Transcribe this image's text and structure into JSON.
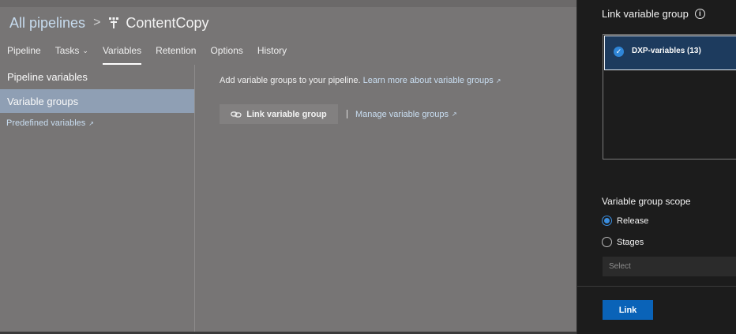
{
  "header": {
    "breadcrumb_root": "All pipelines",
    "separator": ">",
    "pipeline_name": "ContentCopy"
  },
  "tabs": [
    {
      "label": "Pipeline"
    },
    {
      "label": "Tasks"
    },
    {
      "label": "Variables",
      "active": true
    },
    {
      "label": "Retention"
    },
    {
      "label": "Options"
    },
    {
      "label": "History"
    }
  ],
  "sidebar": {
    "pipeline_variables": "Pipeline variables",
    "variable_groups": "Variable groups",
    "predefined_variables": "Predefined variables"
  },
  "content": {
    "intro_text": "Add variable groups to your pipeline.",
    "learn_more": "Learn more about variable groups",
    "link_button": "Link variable group",
    "manage_link": "Manage variable groups"
  },
  "panel": {
    "title": "Link variable group",
    "selected_group": "DXP-variables (13)",
    "scope_title": "Variable group scope",
    "scope_options": [
      "Release",
      "Stages"
    ],
    "scope_selected": "Release",
    "select_placeholder": "Select",
    "link_button": "Link"
  },
  "colors": {
    "accent": "#0a63b8",
    "link": "#c9def2",
    "panel_bg": "#1c1c1c",
    "selected_item": "#1d3b5e"
  }
}
